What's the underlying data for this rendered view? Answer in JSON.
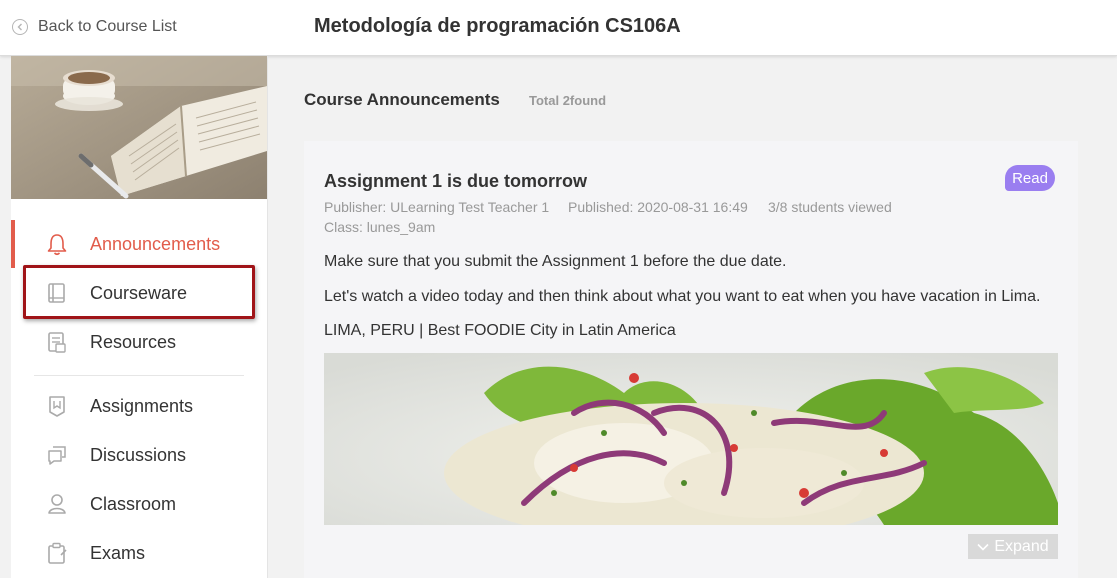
{
  "header": {
    "back_label": "Back to Course List",
    "course_title": "Metodología de programación CS106A"
  },
  "sidebar": {
    "items": [
      {
        "label": "Announcements",
        "icon": "bell-icon",
        "active": true
      },
      {
        "label": "Courseware",
        "icon": "book-icon",
        "active": false
      },
      {
        "label": "Resources",
        "icon": "resources-icon",
        "active": false
      },
      {
        "label": "Assignments",
        "icon": "assignment-icon",
        "active": false
      },
      {
        "label": "Discussions",
        "icon": "discussion-icon",
        "active": false
      },
      {
        "label": "Classroom",
        "icon": "person-icon",
        "active": false
      },
      {
        "label": "Exams",
        "icon": "clipboard-icon",
        "active": false
      }
    ]
  },
  "main": {
    "title": "Course Announcements",
    "total": "Total 2found",
    "announcement": {
      "title": "Assignment 1 is due tomorrow",
      "badge": "Read",
      "publisher": "Publisher: ULearning Test Teacher 1",
      "published": "Published: 2020-08-31 16:49",
      "views": "3/8 students viewed",
      "class": "Class: lunes_9am",
      "paragraphs": [
        "Make sure that you submit the Assignment 1 before the due date.",
        "Let's watch a video today and then think about what you want to eat when you have vacation in Lima.",
        "LIMA, PERU | Best FOODIE City in Latin America"
      ],
      "expand_label": "Expand"
    }
  },
  "colors": {
    "accent": "#e25c4b",
    "badge": "#9a7ef0",
    "highlight_box": "#a01418"
  }
}
